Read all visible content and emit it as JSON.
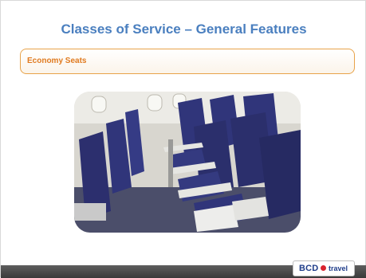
{
  "slide": {
    "title": "Classes of Service – General Features",
    "subtitle": "Economy Seats"
  },
  "image": {
    "description_icon": "airplane-economy-seats-photo"
  },
  "logo": {
    "brand": "BCD",
    "suffix": "travel"
  },
  "colors": {
    "title": "#4a7fbf",
    "subtitle_text": "#e07a1f",
    "subtitle_border": "#e8a34a",
    "footer": "#4a4a4a",
    "logo_blue": "#1f3d8a",
    "logo_red": "#d9232e"
  }
}
